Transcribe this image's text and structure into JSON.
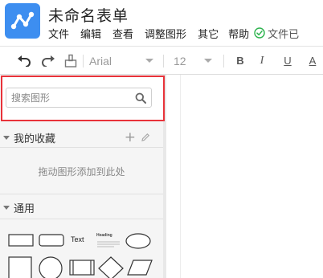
{
  "app": {
    "title": "未命名表单"
  },
  "menu": {
    "items": [
      "文件",
      "编辑",
      "查看",
      "调整图形",
      "其它",
      "帮助"
    ],
    "save_status": "文件已"
  },
  "toolbar": {
    "undo_icon": "undo-icon",
    "redo_icon": "redo-icon",
    "format_painter_icon": "format-painter-icon",
    "font_family": "Arial",
    "font_size": "12",
    "bold": "B",
    "italic": "I",
    "underline": "U",
    "font_color": "A"
  },
  "sidebar": {
    "search": {
      "placeholder": "搜索图形",
      "value": ""
    },
    "favorites": {
      "label": "我的收藏",
      "empty_hint": "拖动图形添加到此处"
    },
    "general": {
      "label": "通用",
      "shapes": [
        "rectangle",
        "rounded-rectangle",
        "text",
        "heading",
        "ellipse",
        "square",
        "circle",
        "process",
        "diamond",
        "parallelogram"
      ],
      "text_shape_label": "Text",
      "heading_shape_label": "Heading"
    }
  },
  "colors": {
    "accent": "#3d8ef0",
    "highlight": "#e8333a",
    "save_ok": "#2bb24c"
  }
}
